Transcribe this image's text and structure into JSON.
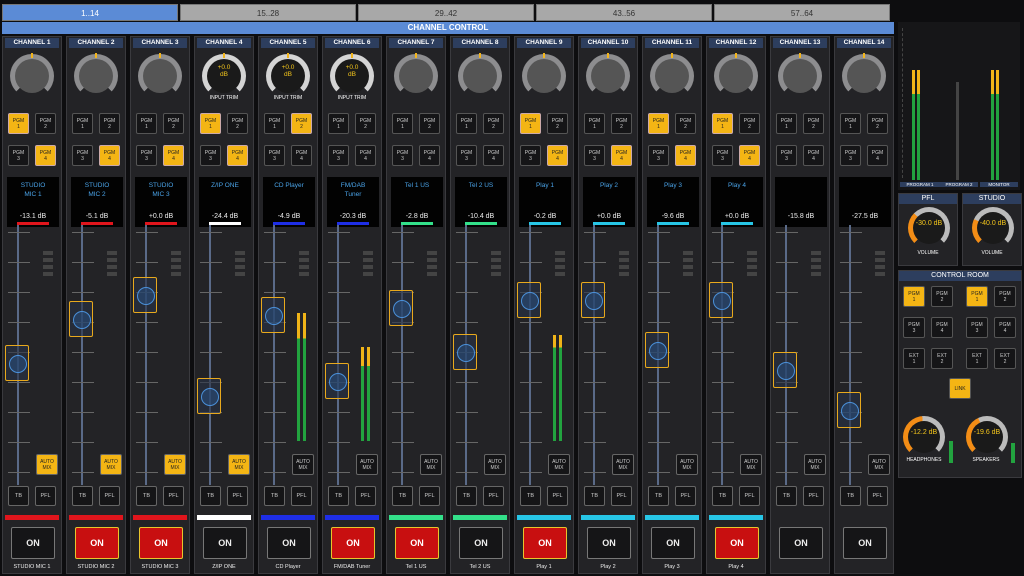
{
  "tabs": [
    "1..14",
    "15..28",
    "29..42",
    "43..56",
    "57..64"
  ],
  "channel_control": "CHANNEL CONTROL",
  "pgm_labels": [
    "PGM\n1",
    "PGM\n2",
    "PGM\n3",
    "PGM\n4"
  ],
  "channels": [
    {
      "name": "CHANNEL 1",
      "display": "STUDIO\nMIC 1",
      "level": "-13.1 dB",
      "color": "#e0151c",
      "bottom": "STUDIO MIC 1",
      "pgm": [
        1,
        0,
        0,
        1
      ],
      "on": false,
      "automix": true,
      "trim": false,
      "cap": 0.52
    },
    {
      "name": "CHANNEL 2",
      "display": "STUDIO\nMIC 2",
      "level": "-5.1 dB",
      "color": "#e0151c",
      "bottom": "STUDIO MIC 2",
      "pgm": [
        0,
        0,
        0,
        1
      ],
      "on": true,
      "automix": true,
      "trim": false,
      "cap": 0.32
    },
    {
      "name": "CHANNEL 3",
      "display": "STUDIO\nMIC 3",
      "level": "+0.0 dB",
      "color": "#e0151c",
      "bottom": "STUDIO MIC 3",
      "pgm": [
        0,
        0,
        0,
        1
      ],
      "on": true,
      "automix": true,
      "trim": false,
      "cap": 0.21
    },
    {
      "name": "CHANNEL 4",
      "display": "Z/IP ONE",
      "level": "-24.4 dB",
      "color": "#ffffff",
      "bottom": "Z/IP ONE",
      "pgm": [
        1,
        0,
        0,
        1
      ],
      "on": false,
      "automix": true,
      "trim": true,
      "trim_val": "+0.0\ndB",
      "cap": 0.67
    },
    {
      "name": "CHANNEL 5",
      "display": "CD Player",
      "level": "-4.9 dB",
      "color": "#1e2ee6",
      "bottom": "CD Player",
      "pgm": [
        0,
        1,
        0,
        0
      ],
      "on": false,
      "automix": false,
      "trim": true,
      "trim_val": "+0.0\ndB",
      "cap": 0.3
    },
    {
      "name": "CHANNEL 6",
      "display": "FM/DAB\nTuner",
      "level": "-20.3 dB",
      "color": "#1e2ee6",
      "bottom": "FM/DAB Tuner",
      "pgm": [
        0,
        0,
        0,
        0
      ],
      "on": true,
      "automix": false,
      "trim": true,
      "trim_val": "+0.0\ndB",
      "cap": 0.6
    },
    {
      "name": "CHANNEL 7",
      "display": "Tel 1 US",
      "level": "-2.8 dB",
      "color": "#33e08a",
      "bottom": "Tel 1 US",
      "pgm": [
        0,
        0,
        0,
        0
      ],
      "on": true,
      "automix": false,
      "trim": false,
      "cap": 0.27
    },
    {
      "name": "CHANNEL 8",
      "display": "Tel 2 US",
      "level": "-10.4 dB",
      "color": "#33e08a",
      "bottom": "Tel 2 US",
      "pgm": [
        0,
        0,
        0,
        0
      ],
      "on": false,
      "automix": false,
      "trim": false,
      "cap": 0.47
    },
    {
      "name": "CHANNEL 9",
      "display": "Play 1",
      "level": "-0.2 dB",
      "color": "#27c6e6",
      "bottom": "Play 1",
      "pgm": [
        1,
        0,
        0,
        1
      ],
      "on": true,
      "automix": false,
      "trim": false,
      "cap": 0.23
    },
    {
      "name": "CHANNEL 10",
      "display": "Play 2",
      "level": "+0.0 dB",
      "color": "#27c6e6",
      "bottom": "Play 2",
      "pgm": [
        0,
        0,
        0,
        1
      ],
      "on": false,
      "automix": false,
      "trim": false,
      "cap": 0.23
    },
    {
      "name": "CHANNEL 11",
      "display": "Play 3",
      "level": "-9.6 dB",
      "color": "#27c6e6",
      "bottom": "Play 3",
      "pgm": [
        1,
        0,
        0,
        1
      ],
      "on": false,
      "automix": false,
      "trim": false,
      "cap": 0.46
    },
    {
      "name": "CHANNEL 12",
      "display": "Play 4",
      "level": "+0.0 dB",
      "color": "#27c6e6",
      "bottom": "Play 4",
      "pgm": [
        1,
        0,
        0,
        1
      ],
      "on": true,
      "automix": false,
      "trim": false,
      "cap": 0.23
    },
    {
      "name": "CHANNEL 13",
      "display": "",
      "level": "-15.8 dB",
      "color": "",
      "bottom": "",
      "pgm": [
        0,
        0,
        0,
        0
      ],
      "on": false,
      "automix": false,
      "trim": false,
      "cap": 0.55
    },
    {
      "name": "CHANNEL 14",
      "display": "",
      "level": "-27.5 dB",
      "color": "",
      "bottom": "",
      "pgm": [
        0,
        0,
        0,
        0
      ],
      "on": false,
      "automix": false,
      "trim": false,
      "cap": 0.73
    }
  ],
  "labels": {
    "tb": "TB",
    "pfl": "PFL",
    "on": "ON",
    "automix": "AUTO\nMIX",
    "input_trim": "INPUT TRIM",
    "link": "LINK",
    "ext1": "EXT\n1",
    "ext2": "EXT\n2"
  },
  "meters": {
    "labels": [
      "PROGRAM 1",
      "PROGRAM 2",
      "MONITOR"
    ]
  },
  "pfl": {
    "title": "PFL",
    "value": "-30.0\ndB",
    "label": "VOLUME"
  },
  "studio": {
    "title": "STUDIO",
    "value": "-40.0\ndB",
    "label": "VOLUME"
  },
  "control_room": {
    "title": "CONTROL ROOM",
    "headphones": "-12.2\ndB",
    "headphones_label": "HEADPHONES",
    "speakers": "-19.6\ndB",
    "speakers_label": "SPEAKERS"
  },
  "colors": {
    "accent": "#f4b514",
    "tab": "#5b8bd6",
    "on_red": "#c80f10"
  }
}
